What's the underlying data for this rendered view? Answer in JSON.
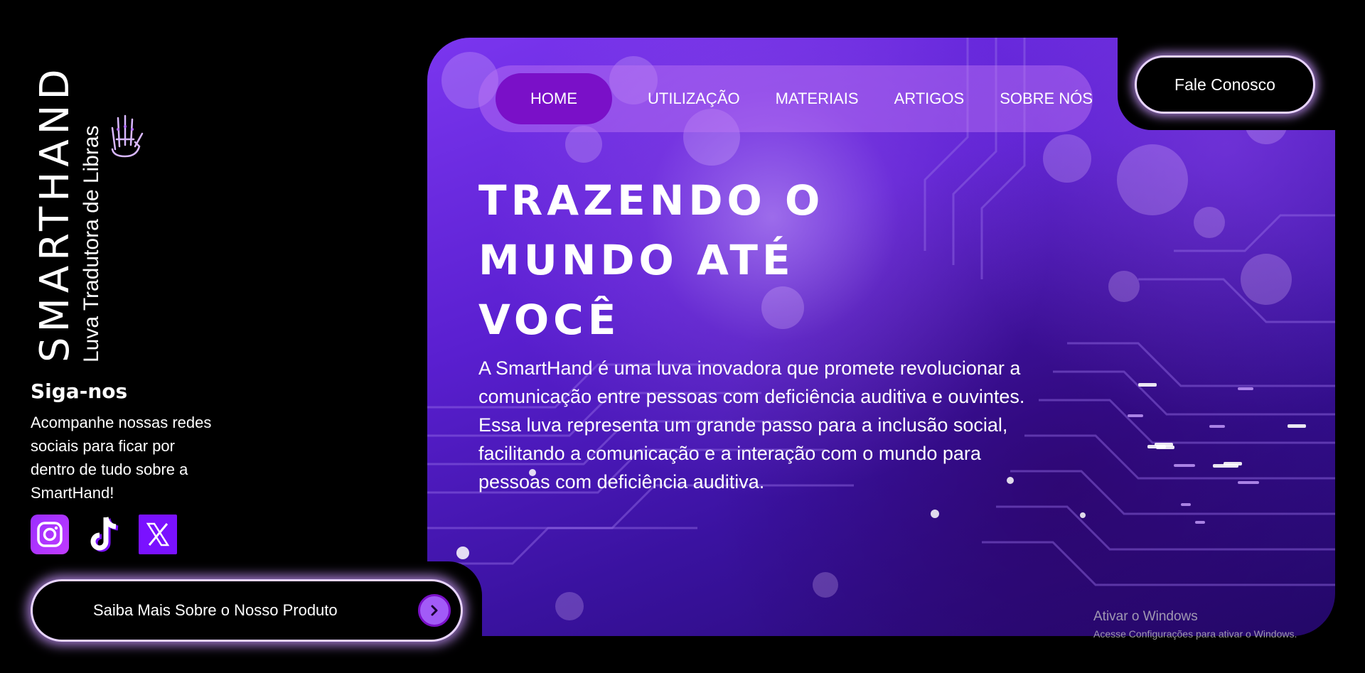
{
  "brand": {
    "name": "SMARTHAND",
    "subtitle": "Luva Tradutora de Libras",
    "icon": "sign-language-hand-icon"
  },
  "nav": {
    "items": [
      {
        "label": "HOME",
        "active": true
      },
      {
        "label": "UTILIZAÇÃO"
      },
      {
        "label": "MATERIAIS"
      },
      {
        "label": "ARTIGOS"
      },
      {
        "label": "SOBRE NÓS"
      }
    ]
  },
  "contact_button": "Fale Conosco",
  "hero": {
    "headline_line1": "Trazendo o",
    "headline_line2": "mundo até",
    "headline_line3": "você",
    "description": "A SmartHand é uma luva inovadora que promete revolucionar a comunicação entre pessoas com deficiência auditiva e ouvintes. Essa luva representa um grande passo para a inclusão social, facilitando a comunicação e a interação com o mundo para pessoas com deficiência auditiva."
  },
  "follow": {
    "title": "Siga-nos",
    "text": "Acompanhe nossas redes sociais para ficar por dentro de tudo sobre a SmartHand!",
    "socials": [
      {
        "name": "instagram-icon"
      },
      {
        "name": "tiktok-icon"
      },
      {
        "name": "x-icon"
      }
    ]
  },
  "cta": {
    "label": "Saiba Mais Sobre o Nosso Produto",
    "icon": "chevron-right-icon"
  },
  "watermark": {
    "line1": "Ativar o Windows",
    "line2": "Acesse Configurações para ativar o Windows."
  },
  "colors": {
    "accent": "#7a10c8",
    "glow": "#e8d4ff",
    "hero_purple": "#5a1fd0"
  }
}
